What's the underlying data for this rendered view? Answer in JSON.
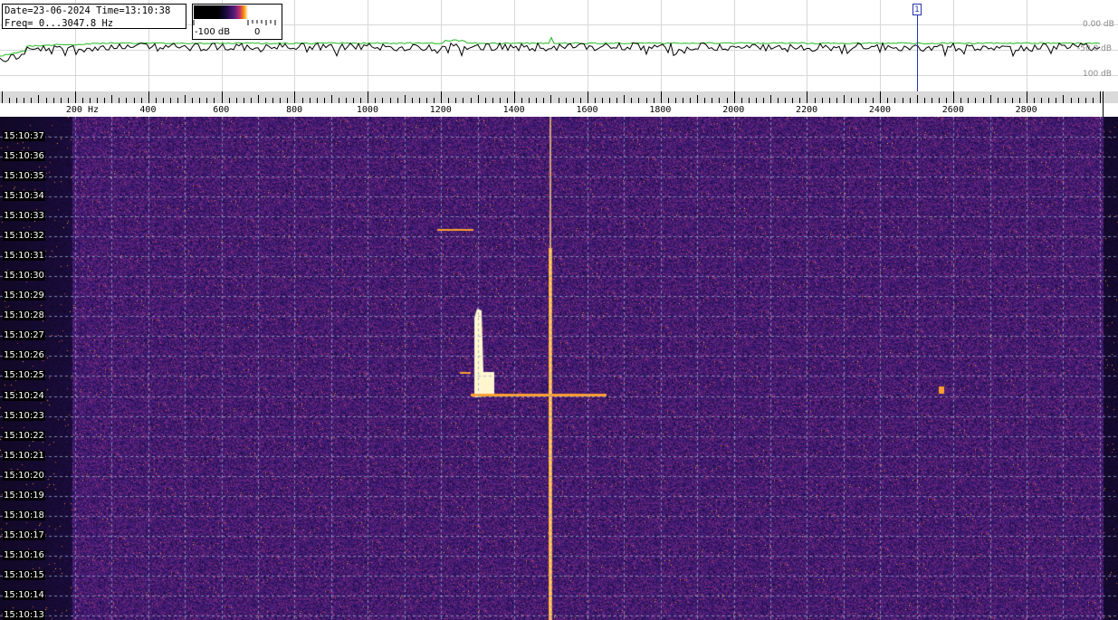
{
  "info": {
    "line1": "Date=23-06-2024 Time=13:10:38",
    "line2": "Freq= 0...3047.8 Hz"
  },
  "colorbar": {
    "min_label": "-100 dB",
    "max_label": "0"
  },
  "spectrum": {
    "db_labels": [
      "0.00 dB",
      "-50.0 dB",
      "100 dB"
    ],
    "marker_label": "1",
    "marker_freq_hz": 2500,
    "colors": {
      "current": "#000000",
      "peak": "#22bb22",
      "marker": "#2233aa"
    }
  },
  "ruler": {
    "freq_labels": [
      {
        "hz": 200,
        "text": "200 Hz"
      },
      {
        "hz": 400,
        "text": "400"
      },
      {
        "hz": 600,
        "text": "600"
      },
      {
        "hz": 800,
        "text": "800"
      },
      {
        "hz": 1000,
        "text": "1000"
      },
      {
        "hz": 1200,
        "text": "1200"
      },
      {
        "hz": 1400,
        "text": "1400"
      },
      {
        "hz": 1600,
        "text": "1600"
      },
      {
        "hz": 1800,
        "text": "1800"
      },
      {
        "hz": 2000,
        "text": "2000"
      },
      {
        "hz": 2200,
        "text": "2200"
      },
      {
        "hz": 2400,
        "text": "2400"
      },
      {
        "hz": 2600,
        "text": "2600"
      },
      {
        "hz": 2800,
        "text": "2800"
      }
    ]
  },
  "waterfall": {
    "times": [
      "15:10:37",
      "15:10:36",
      "15:10:35",
      "15:10:34",
      "15:10:33",
      "15:10:32",
      "15:10:31",
      "15:10:30",
      "15:10:29",
      "15:10:28",
      "15:10:27",
      "15:10:26",
      "15:10:25",
      "15:10:24",
      "15:10:23",
      "15:10:22",
      "15:10:21",
      "15:10:20",
      "15:10:19",
      "15:10:18",
      "15:10:17",
      "15:10:16",
      "15:10:15",
      "15:10:14",
      "15:10:13"
    ],
    "carrier_freq_hz": 1500,
    "burst_freq_hz": 1300,
    "colors": {
      "background": "#14082a",
      "signal": "#ffa020",
      "grid": "#8fa0c0"
    }
  }
}
